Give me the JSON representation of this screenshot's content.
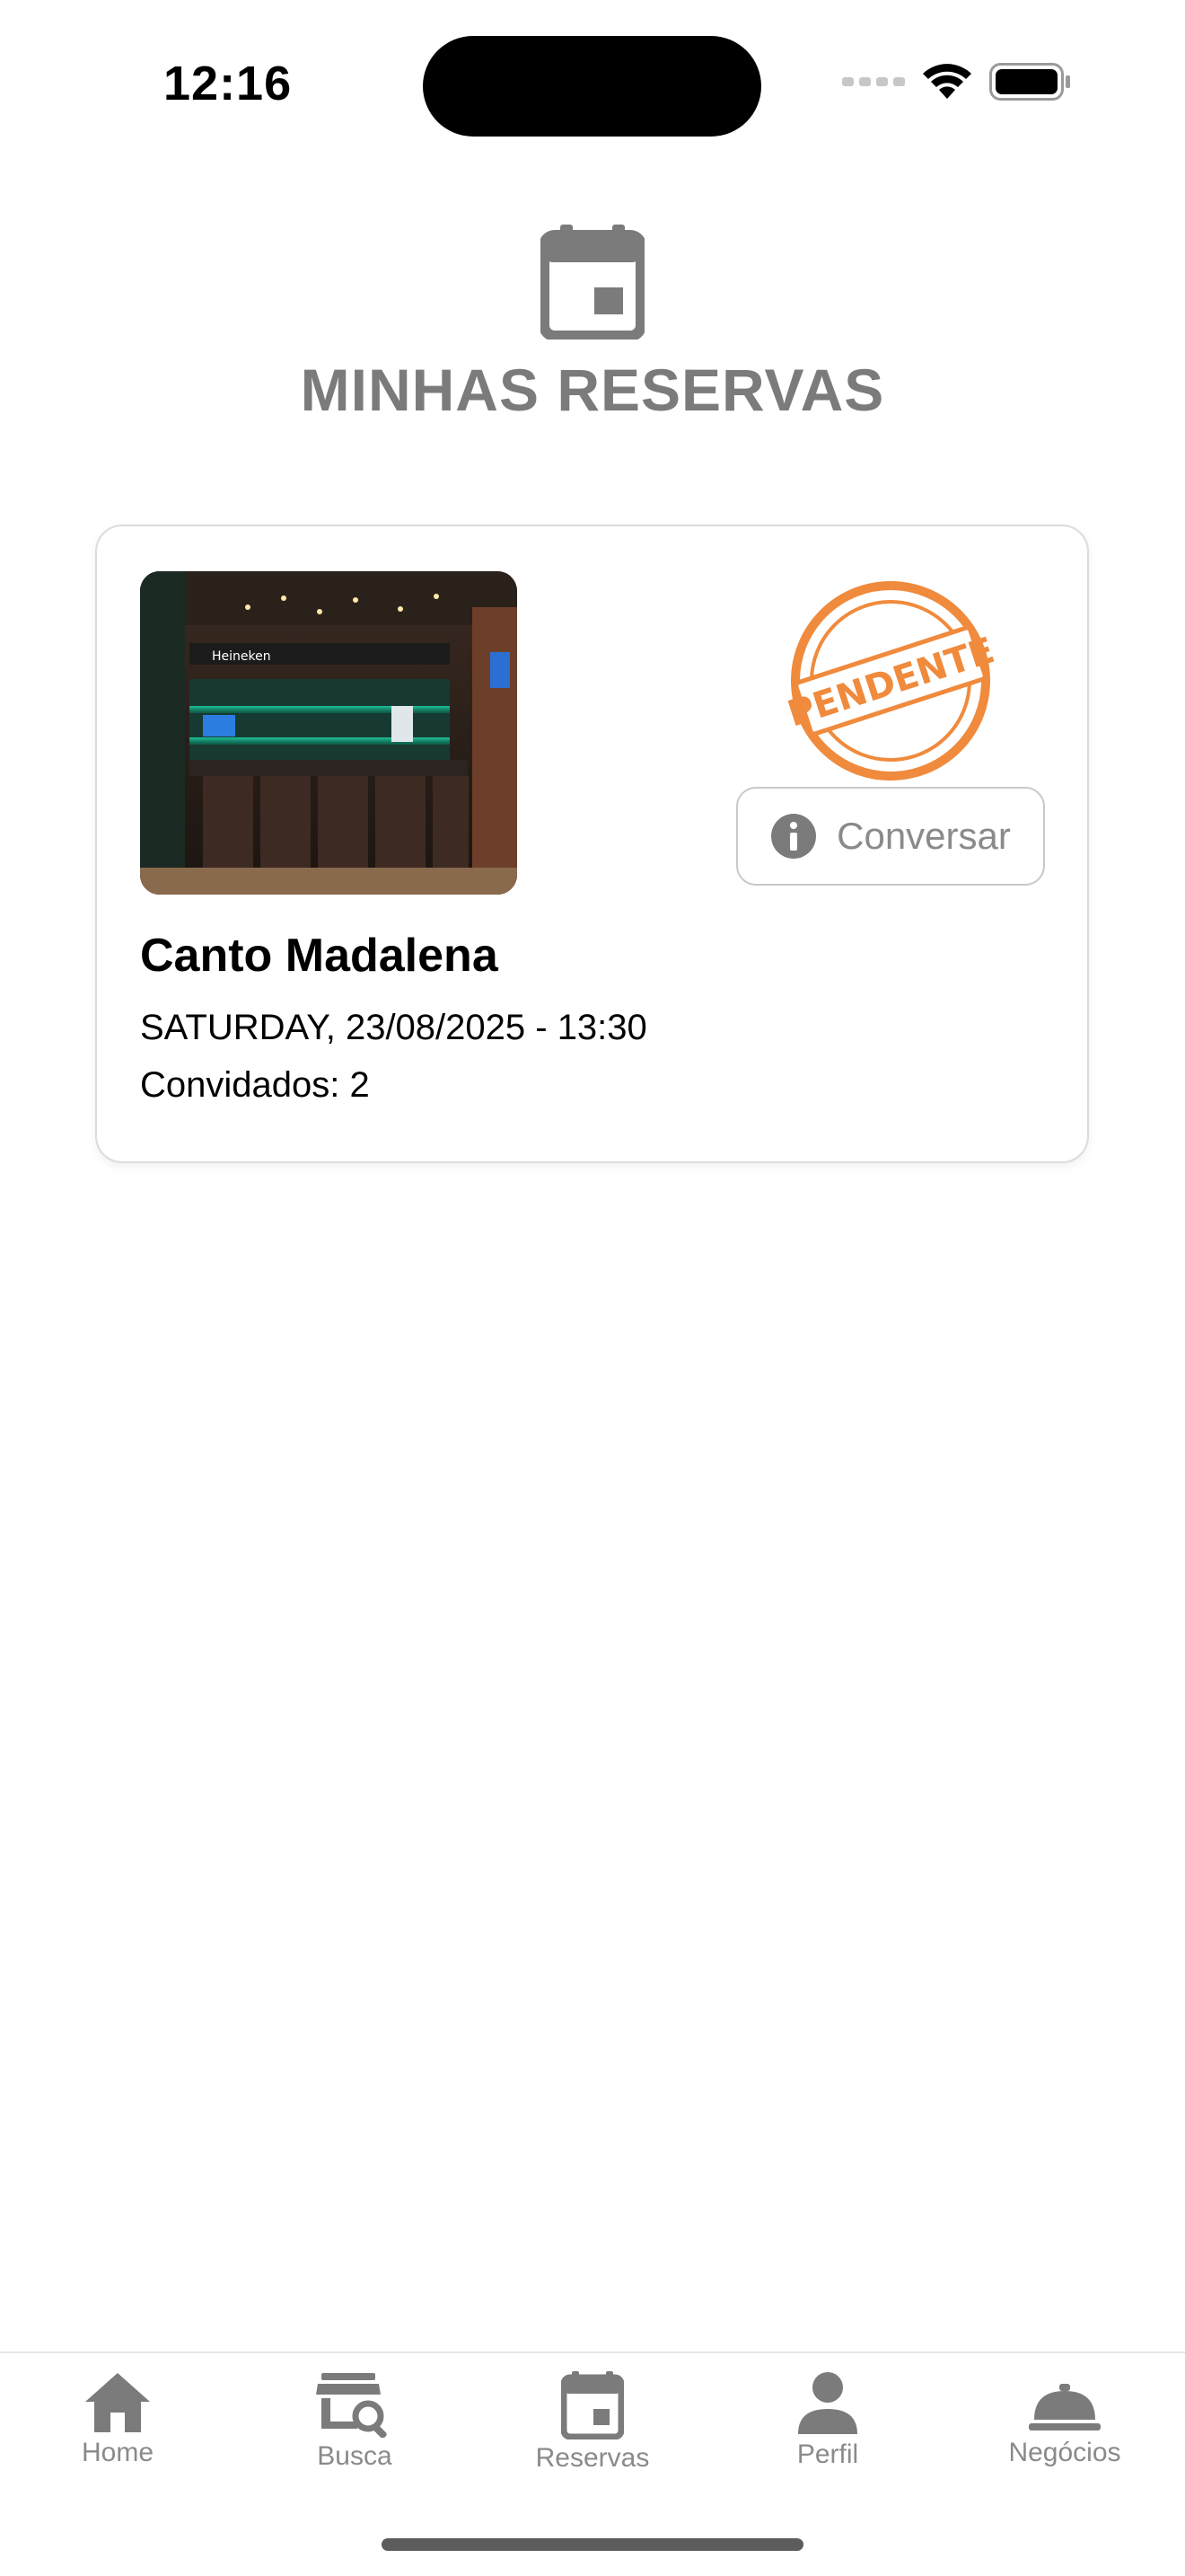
{
  "status_bar": {
    "time": "12:16"
  },
  "header": {
    "icon": "calendar-icon",
    "title": "MINHAS RESERVAS"
  },
  "reservation": {
    "venue_name": "Canto Madalena",
    "datetime": "SATURDAY, 23/08/2025 - 13:30",
    "guests": "Convidados: 2",
    "status_stamp": "PENDENTE",
    "chat_button_label": "Conversar",
    "chat_icon": "info-icon",
    "photo_sign": "Heineken"
  },
  "tab_bar": {
    "items": [
      {
        "label": "Home",
        "icon": "home-icon"
      },
      {
        "label": "Busca",
        "icon": "store-search-icon"
      },
      {
        "label": "Reservas",
        "icon": "calendar-icon"
      },
      {
        "label": "Perfil",
        "icon": "person-icon"
      },
      {
        "label": "Negócios",
        "icon": "cloche-icon"
      }
    ]
  },
  "colors": {
    "icon_gray": "#7b7b7b",
    "stamp_orange": "#f08a3c",
    "text_gray": "#8a8a8a"
  }
}
